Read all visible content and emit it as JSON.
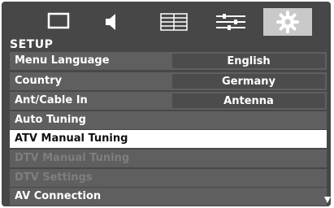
{
  "tabs": [
    {
      "icon": "picture-icon",
      "active": false
    },
    {
      "icon": "sound-icon",
      "active": false
    },
    {
      "icon": "channel-list-icon",
      "active": false
    },
    {
      "icon": "preferences-icon",
      "active": false
    },
    {
      "icon": "setup-gear-icon",
      "active": true
    }
  ],
  "menu": {
    "title": "SETUP",
    "items": [
      {
        "label": "Menu Language",
        "value": "English"
      },
      {
        "label": "Country",
        "value": "Germany"
      },
      {
        "label": "Ant/Cable In",
        "value": "Antenna"
      },
      {
        "label": "Auto Tuning"
      },
      {
        "label": "ATV Manual Tuning",
        "selected": true
      },
      {
        "label": "DTV Manual Tuning",
        "disabled": true
      },
      {
        "label": "DTV Settings",
        "disabled": true
      },
      {
        "label": "AV Connection"
      }
    ]
  },
  "colors": {
    "background": "#474747",
    "row": "#5f5f5f",
    "value_box": "#4c4c4c",
    "selected_row": "#ffffff",
    "disabled_text": "#7e7e7e"
  }
}
